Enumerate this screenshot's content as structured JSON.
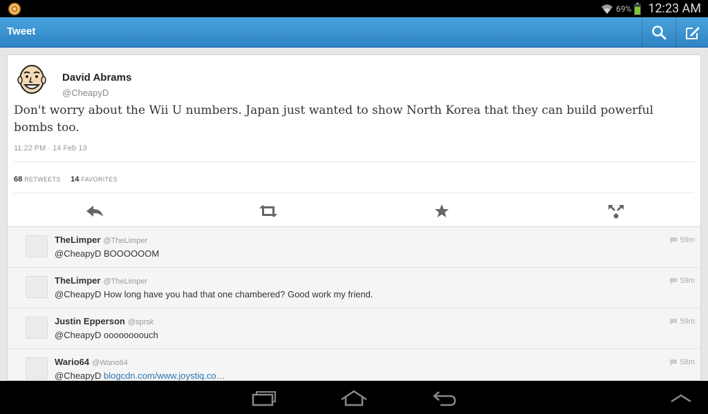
{
  "status_bar": {
    "battery_percent": "69%",
    "time": "12:23 AM",
    "icons": [
      "app-notification-icon",
      "wifi-icon",
      "battery-icon"
    ]
  },
  "action_bar": {
    "title": "Tweet",
    "buttons": [
      "search-icon",
      "compose-icon"
    ],
    "accent": "#3a93d0"
  },
  "tweet": {
    "author_name": "David Abrams",
    "author_handle": "@CheapyD",
    "text": "Don't worry about the Wii U numbers. Japan just wanted to show North Korea that they can build powerful bombs too.",
    "timestamp": "11:22 PM · 14 Feb 13",
    "retweets_count": "68",
    "retweets_label": "RETWEETS",
    "favorites_count": "14",
    "favorites_label": "FAVORITES",
    "actions": [
      "reply-icon",
      "retweet-icon",
      "favorite-icon",
      "share-icon"
    ]
  },
  "replies": [
    {
      "name": "TheLimper",
      "handle": "@TheLimper",
      "text": "@CheapyD BOOOOOOM",
      "link": "",
      "time": "59m"
    },
    {
      "name": "TheLimper",
      "handle": "@TheLimper",
      "text": "@CheapyD How long have you had that one chambered? Good work my friend.",
      "link": "",
      "time": "59m"
    },
    {
      "name": "Justin Epperson",
      "handle": "@sprsk",
      "text": "@CheapyD oooooooouch",
      "link": "",
      "time": "59m"
    },
    {
      "name": "Wario64",
      "handle": "@Wario64",
      "text": "@CheapyD ",
      "link": "blogcdn.com/www.joystiq.co…",
      "time": "58m"
    }
  ],
  "nav_bar": {
    "buttons": [
      "recent-apps-icon",
      "home-icon",
      "back-icon",
      "menu-up-icon"
    ]
  }
}
